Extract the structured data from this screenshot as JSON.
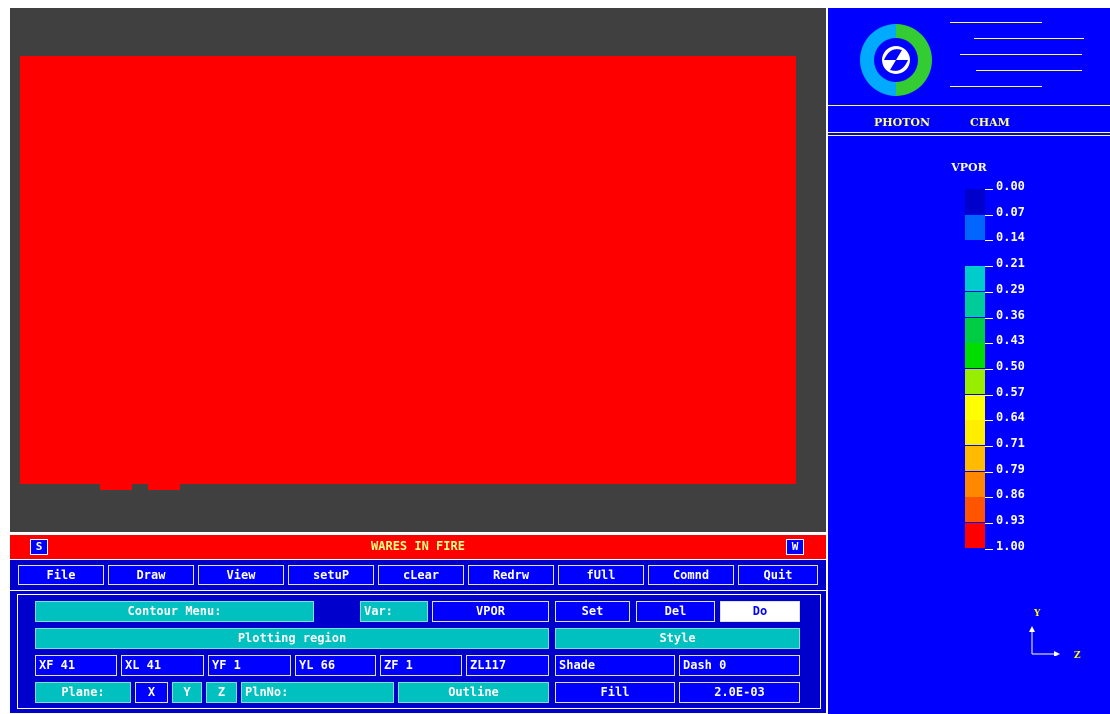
{
  "title_bar": {
    "left_button": "S",
    "title": "WARES IN FIRE",
    "right_button": "W"
  },
  "menu": [
    "File",
    "Draw",
    "View",
    "setuP",
    "cLear",
    "Redrw",
    "fUll",
    "Comnd",
    "Quit"
  ],
  "panel": {
    "contour_menu": "Contour Menu:",
    "var_label": "Var:",
    "var_value": "VPOR",
    "set": "Set",
    "del": "Del",
    "do": "Do",
    "plotting_region": "Plotting region",
    "style": "Style",
    "xf": "XF 41",
    "xl": "XL 41",
    "yf": "YF  1",
    "yl": "YL 66",
    "zf": "ZF  1",
    "zl": "ZL117",
    "shade": "Shade",
    "dash": "Dash 0",
    "plane_label": "Plane:",
    "plane_x": "X",
    "plane_y": "Y",
    "plane_z": "Z",
    "plnno": "PlnNo:",
    "outline": "Outline",
    "fill": "Fill",
    "fill_value": "2.0E-03"
  },
  "sidebar": {
    "brand_left": "PHOTON",
    "brand_right": "CHAM",
    "legend_variable": "VPOR",
    "legend_ticks": [
      "0.00",
      "0.07",
      "0.14",
      "0.21",
      "0.29",
      "0.36",
      "0.43",
      "0.50",
      "0.57",
      "0.64",
      "0.71",
      "0.79",
      "0.86",
      "0.93",
      "1.00"
    ],
    "legend_colors": [
      "#0000cc",
      "#0066ff",
      "#0000ff",
      "#00cccc",
      "#00cc99",
      "#00cc44",
      "#00dd00",
      "#99ee00",
      "#ffff00",
      "#ffee00",
      "#ffbb00",
      "#ff8800",
      "#ff5500",
      "#ff0000"
    ],
    "axis_y": "Y",
    "axis_z": "Z"
  },
  "colors": {
    "field": "#ff0000",
    "background": "#404040",
    "panel": "#0000cc",
    "accent": "#00c0c0"
  }
}
